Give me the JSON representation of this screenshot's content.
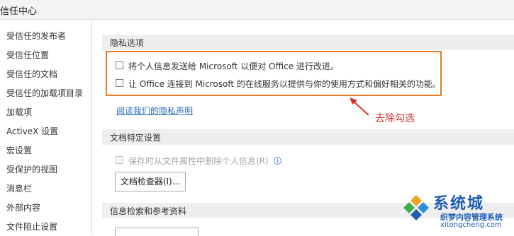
{
  "window": {
    "title": "信任中心"
  },
  "sidebar": {
    "items": [
      {
        "label": "受信任的发布者"
      },
      {
        "label": "受信任位置"
      },
      {
        "label": "受信任的文档"
      },
      {
        "label": "受信任的加载项目录"
      },
      {
        "label": "加载项"
      },
      {
        "label": "ActiveX 设置"
      },
      {
        "label": "宏设置"
      },
      {
        "label": "受保护的视图"
      },
      {
        "label": "消息栏"
      },
      {
        "label": "外部内容"
      },
      {
        "label": "文件阻止设置"
      }
    ]
  },
  "privacy": {
    "header": "隐私选项",
    "options": [
      {
        "label": "将个人信息发送给 Microsoft 以便对 Office 进行改进。",
        "checked": false
      },
      {
        "label": "让 Office 连接到 Microsoft 的在线服务以提供与你的使用方式和偏好相关的功能。",
        "checked": false
      }
    ],
    "statement_link": "阅读我们的隐私声明"
  },
  "document_specific": {
    "header": "文档特定设置",
    "remove_personal_info": {
      "label": "保存时从文件属性中删除个人信息(R)",
      "checked": false,
      "enabled": false
    },
    "inspector_button": "文档检查器(I)..."
  },
  "research": {
    "header": "信息检索和参考资料"
  },
  "annotation": {
    "text": "去除勾选",
    "color": "#d0342c",
    "box_color": "#e87b22"
  },
  "watermark": {
    "brand": "系统城",
    "subtitle": "织梦内容管理系统",
    "site": "xitongcheng.com"
  }
}
